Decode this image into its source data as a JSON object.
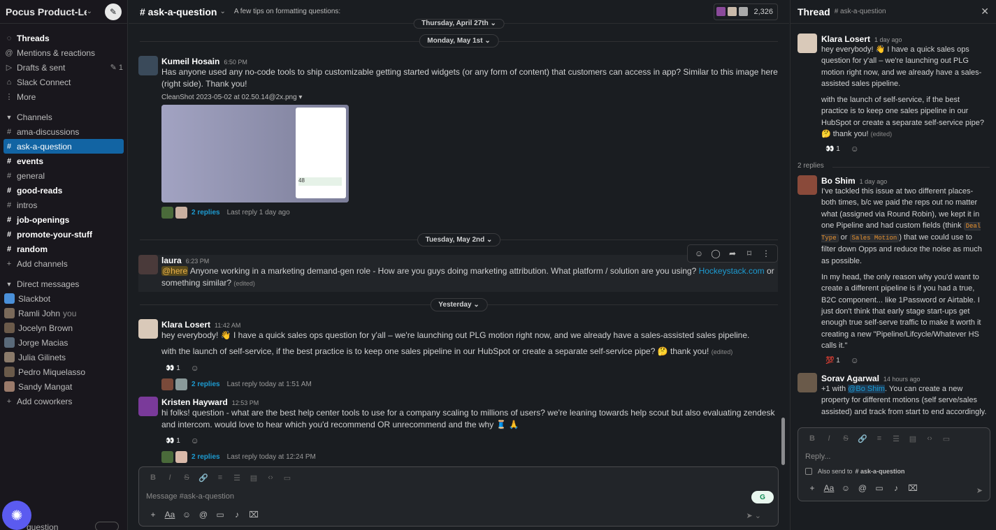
{
  "workspace": {
    "name": "Pocus Product-Le...",
    "compose_icon": "compose-icon"
  },
  "sidebar": {
    "top_items": [
      {
        "label": "Threads",
        "icon": "threads-icon",
        "bold": true
      },
      {
        "label": "Mentions & reactions",
        "icon": "at-icon"
      },
      {
        "label": "Drafts & sent",
        "icon": "send-icon",
        "badge": "1"
      },
      {
        "label": "Slack Connect",
        "icon": "connect-icon"
      },
      {
        "label": "More",
        "icon": "more-icon"
      }
    ],
    "channels_header": "Channels",
    "channels": [
      {
        "label": "ama-discussions",
        "bold": false
      },
      {
        "label": "ask-a-question",
        "bold": false,
        "active": true
      },
      {
        "label": "events",
        "bold": true
      },
      {
        "label": "general",
        "bold": false
      },
      {
        "label": "good-reads",
        "bold": true
      },
      {
        "label": "intros",
        "bold": false
      },
      {
        "label": "job-openings",
        "bold": true
      },
      {
        "label": "promote-your-stuff",
        "bold": true
      },
      {
        "label": "random",
        "bold": true
      }
    ],
    "add_channels": "Add channels",
    "dm_header": "Direct messages",
    "dms": [
      {
        "label": "Slackbot",
        "color": "#4a90d9"
      },
      {
        "label": "Ramli John",
        "suffix": "you",
        "color": "#7a6a5a"
      },
      {
        "label": "Jocelyn Brown",
        "color": "#6b5a4a"
      },
      {
        "label": "Jorge Macias",
        "color": "#5a6a7a"
      },
      {
        "label": "Julia Gilinets",
        "color": "#8a7a6a"
      },
      {
        "label": "Pedro Miquelasso",
        "color": "#6a5a4a"
      },
      {
        "label": "Sandy Mangat",
        "color": "#9a7a6a"
      }
    ],
    "add_coworkers": "Add coworkers",
    "bottom_label": "question"
  },
  "channel": {
    "name": "# ask-a-question",
    "topic": "A few tips on formatting questions:",
    "member_count": "2,326"
  },
  "dates": {
    "thursday": "Thursday, April 27th",
    "monday": "Monday, May 1st",
    "tuesday": "Tuesday, May 2nd",
    "yesterday": "Yesterday"
  },
  "messages": {
    "kumeil": {
      "name": "Kumeil Hosain",
      "time": "6:50 PM",
      "text": "Has anyone used any no-code tools to ship customizable getting started widgets (or any form of content) that customers can access in app? Similar to this image here (right side). Thank you!",
      "file": "CleanShot 2023-05-02 at 02.50.14@2x.png",
      "thumb_number": "48",
      "replies": "2 replies",
      "last_reply": "Last reply 1 day ago"
    },
    "laura": {
      "name": "laura",
      "time": "6:23 PM",
      "mention": "@here",
      "text": " Anyone working in a marketing demand-gen role - How are you guys doing marketing attribution. What platform / solution are you using? ",
      "link": "Hockeystack.com",
      "text2": " or something similar?",
      "edited": "(edited)"
    },
    "klara": {
      "name": "Klara Losert",
      "time": "11:42 AM",
      "line1": "hey everybody! 👋 I have a quick sales ops question for y'all – we're launching out PLG motion right now, and we already have a sales-assisted sales pipeline.",
      "line2": "with the launch of self-service, if the best practice is to keep one sales pipeline in our HubSpot or create a separate self-service pipe? 🤔 thank you!",
      "edited": "(edited)",
      "reaction": "👀 1",
      "replies": "2 replies",
      "last_reply": "Last reply today at 1:51 AM"
    },
    "kristen": {
      "name": "Kristen Hayward",
      "time": "12:53 PM",
      "text": "hi folks! question - what are the best help center tools to use for a company scaling to millions of users?  we're leaning towards help scout but also evaluating zendesk and intercom.  would love to hear which you'd recommend OR unrecommend and the why 🧵 🙏",
      "reaction": "👀 1",
      "replies": "2 replies",
      "last_reply": "Last reply today at 12:24 PM"
    }
  },
  "composer": {
    "placeholder": "Message #ask-a-question"
  },
  "thread": {
    "title": "Thread",
    "channel": "# ask-a-question",
    "parent": {
      "name": "Klara Losert",
      "time": "1 day ago",
      "p1": "hey everybody! 👋 I have a quick sales ops question for y'all – we're launching out PLG motion right now, and we already have a sales-assisted sales pipeline.",
      "p2": "with the launch of self-service, if the best practice is to keep one sales pipeline in our HubSpot or create a separate self-service pipe? 🤔 thank you!",
      "edited": "(edited)",
      "reaction": "👀 1"
    },
    "reply_count": "2 replies",
    "bo": {
      "name": "Bo Shim",
      "time": "1 day ago",
      "p1a": "I've tackled this issue at two different places- both times, b/c we paid the reps out no matter what (assigned via Round Robin), we kept it in one Pipeline and had custom fields (think ",
      "code1": "Deal Type",
      "p1b": " or ",
      "code2": "Sales Motion",
      "p1c": ") that we could use to filter down Opps and reduce the noise as much as possible.",
      "p2": "In my head, the only reason why you'd want to create a different pipeline is if you had a true, B2C component... like 1Password or Airtable. I just don't think that early stage start-ups get enough true self-serve traffic to make it worth it creating a new \"Pipeline/Lifcycle/Whatever HS calls it.\"",
      "reaction": "💯 1"
    },
    "sorav": {
      "name": "Sorav Agarwal",
      "time": "14 hours ago",
      "pre": "+1 with ",
      "mention": "@Bo Shim",
      "post": ". You can create a new property for different motions (self serve/sales assisted) and track from start to end accordingly."
    },
    "reply_placeholder": "Reply...",
    "also_send": "Also send to",
    "also_channel": "# ask-a-question"
  }
}
